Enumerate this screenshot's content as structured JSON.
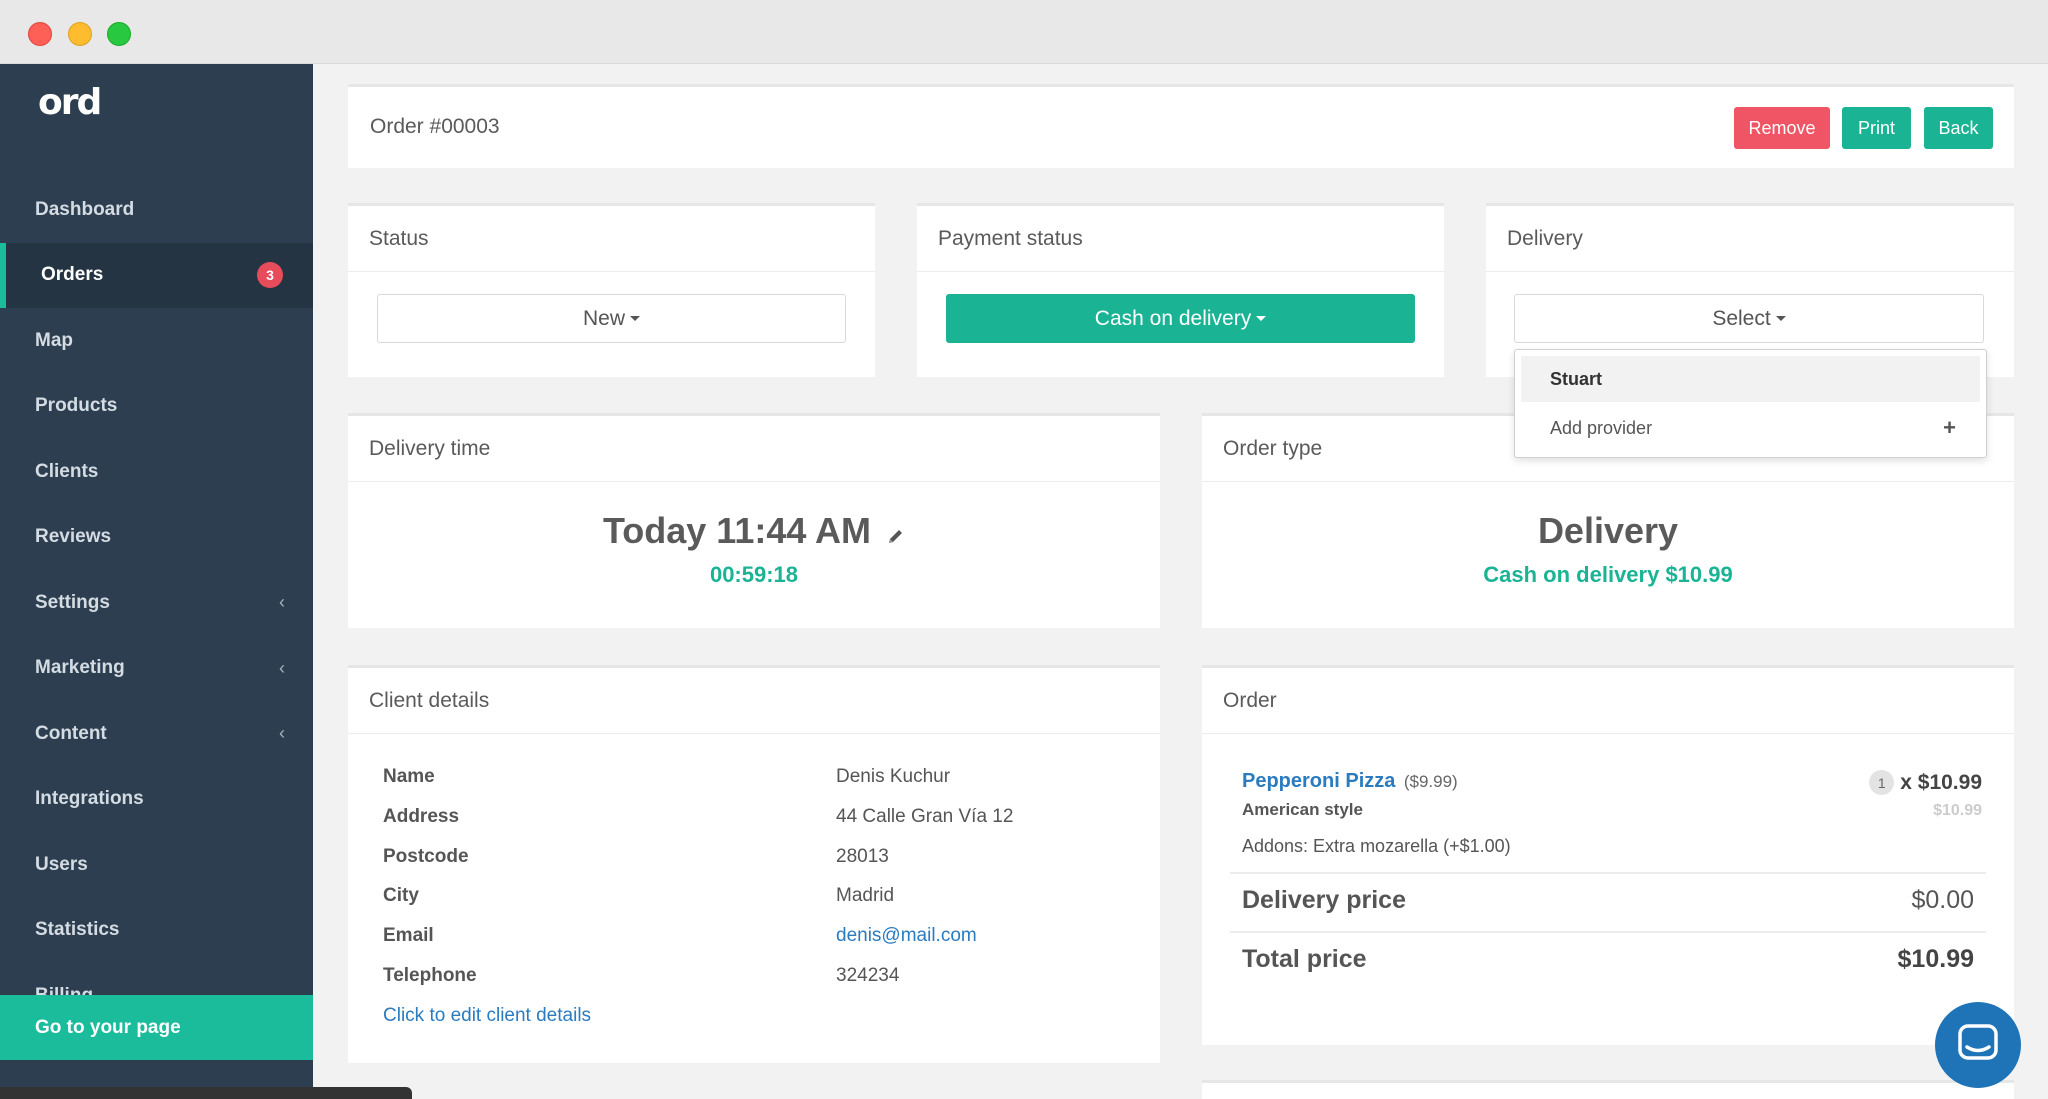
{
  "sidebar": {
    "logo": "ord",
    "items": [
      {
        "label": "Dashboard"
      },
      {
        "label": "Orders",
        "badge": "3"
      },
      {
        "label": "Map"
      },
      {
        "label": "Products"
      },
      {
        "label": "Clients"
      },
      {
        "label": "Reviews"
      },
      {
        "label": "Settings",
        "chevron": "‹"
      },
      {
        "label": "Marketing",
        "chevron": "‹"
      },
      {
        "label": "Content",
        "chevron": "‹"
      },
      {
        "label": "Integrations"
      },
      {
        "label": "Users"
      },
      {
        "label": "Statistics"
      },
      {
        "label": "Billing"
      }
    ],
    "goto": "Go to your page"
  },
  "header": {
    "title": "Order #00003",
    "remove": "Remove",
    "print": "Print",
    "back": "Back"
  },
  "status": {
    "title": "Status",
    "value": "New"
  },
  "payment": {
    "title": "Payment status",
    "value": "Cash on delivery"
  },
  "delivery": {
    "title": "Delivery",
    "value": "Select",
    "options": [
      "Stuart",
      "Add provider"
    ]
  },
  "delivery_time": {
    "title": "Delivery time",
    "time": "Today 11:44 AM",
    "countdown": "00:59:18"
  },
  "order_type": {
    "title": "Order type",
    "type": "Delivery",
    "payment": "Cash on delivery $10.99"
  },
  "client": {
    "title": "Client details",
    "rows": [
      {
        "label": "Name",
        "value": "Denis Kuchur"
      },
      {
        "label": "Address",
        "value": "44 Calle Gran Vía 12"
      },
      {
        "label": "Postcode",
        "value": "28013"
      },
      {
        "label": "City",
        "value": "Madrid"
      },
      {
        "label": "Email",
        "value": "denis@mail.com"
      },
      {
        "label": "Telephone",
        "value": "324234"
      }
    ],
    "edit_link": "Click to edit client details"
  },
  "order": {
    "title": "Order",
    "item": {
      "name": "Pepperoni Pizza",
      "unit_price": "($9.99)",
      "variant": "American style",
      "addons": "Addons: Extra mozarella (+$1.00)",
      "qty": "1",
      "line_total": "x $10.99",
      "subtotal": "$10.99"
    },
    "delivery_label": "Delivery price",
    "delivery_value": "$0.00",
    "total_label": "Total price",
    "total_value": "$10.99"
  },
  "colors": {
    "sidebar": "#2c3e50",
    "accent": "#1ab394",
    "danger": "#ef5565",
    "link": "#2a7bbf"
  }
}
